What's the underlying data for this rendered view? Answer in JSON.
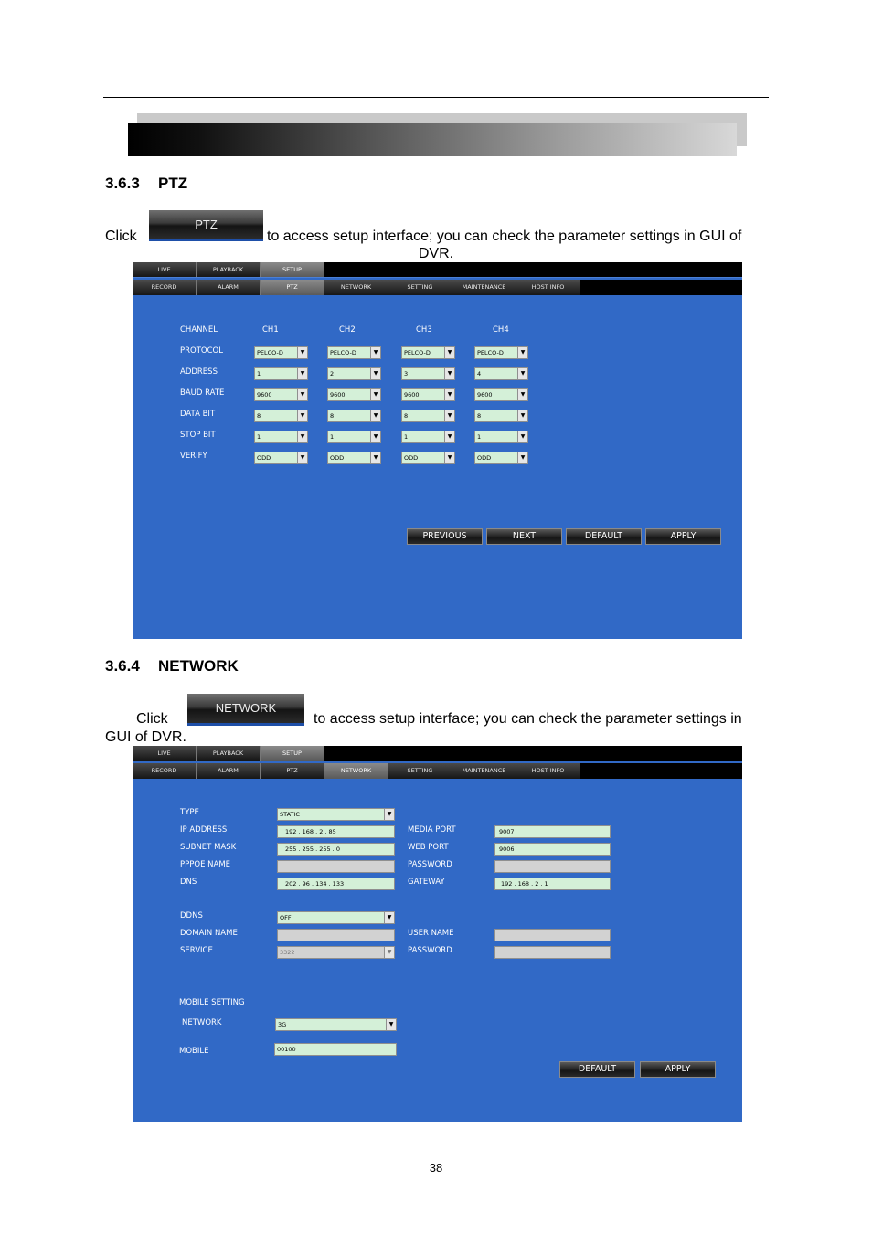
{
  "page_number": "38",
  "sections": {
    "ptz": {
      "number": "3.6.3",
      "title": "PTZ",
      "para_click": "Click",
      "button_label": "PTZ",
      "para_text": "to access setup interface; you can check the parameter settings in GUI of",
      "para_end": "DVR."
    },
    "network": {
      "number": "3.6.4",
      "title": "NETWORK",
      "para_click": "Click",
      "button_label": "NETWORK",
      "para_text": "to access setup interface; you can check the parameter settings in",
      "para_end": "GUI of DVR."
    }
  },
  "tabs_main": [
    "LIVE",
    "PLAYBACK",
    "SETUP"
  ],
  "tabs_sub": [
    "RECORD",
    "ALARM",
    "PTZ",
    "NETWORK",
    "SETTING",
    "MAINTENANCE",
    "HOST INFO"
  ],
  "ptz_screen": {
    "channel_label": "CHANNEL",
    "channels": [
      "CH1",
      "CH2",
      "CH3",
      "CH4"
    ],
    "rows": [
      {
        "label": "PROTOCOL",
        "values": [
          "PELCO-D",
          "PELCO-D",
          "PELCO-D",
          "PELCO-D"
        ]
      },
      {
        "label": "ADDRESS",
        "values": [
          "1",
          "2",
          "3",
          "4"
        ]
      },
      {
        "label": "BAUD RATE",
        "values": [
          "9600",
          "9600",
          "9600",
          "9600"
        ]
      },
      {
        "label": "DATA BIT",
        "values": [
          "8",
          "8",
          "8",
          "8"
        ]
      },
      {
        "label": "STOP BIT",
        "values": [
          "1",
          "1",
          "1",
          "1"
        ]
      },
      {
        "label": "VERIFY",
        "values": [
          "ODD",
          "ODD",
          "ODD",
          "ODD"
        ]
      }
    ],
    "buttons": [
      "PREVIOUS",
      "NEXT",
      "DEFAULT",
      "APPLY"
    ]
  },
  "network_screen": {
    "type_label": "TYPE",
    "type_value": "STATIC",
    "ip_label": "IP ADDRESS",
    "ip_value": "192  .  168  .   2   .   85",
    "mask_label": "SUBNET MASK",
    "mask_value": "255  .  255  .  255  .   0",
    "pppoe_label": "PPPOE NAME",
    "dns_label": "DNS",
    "dns_value": "202  .   96  .  134  .  133",
    "media_port_label": "MEDIA PORT",
    "media_port_value": "9007",
    "web_port_label": "WEB PORT",
    "web_port_value": "9006",
    "password_label": "PASSWORD",
    "gateway_label": "GATEWAY",
    "gateway_value": "192  .  168  .   2   .   1",
    "ddns_label": "DDNS",
    "ddns_value": "OFF",
    "domain_label": "DOMAIN NAME",
    "service_label": "SERVICE",
    "service_value": "3322",
    "user_label": "USER NAME",
    "password2_label": "PASSWORD",
    "mobile_setting_label": "MOBILE SETTING",
    "network_label": "NETWORK",
    "network_value": "3G",
    "mobile_label": "MOBILE",
    "mobile_value": "00100",
    "buttons": [
      "DEFAULT",
      "APPLY"
    ]
  }
}
